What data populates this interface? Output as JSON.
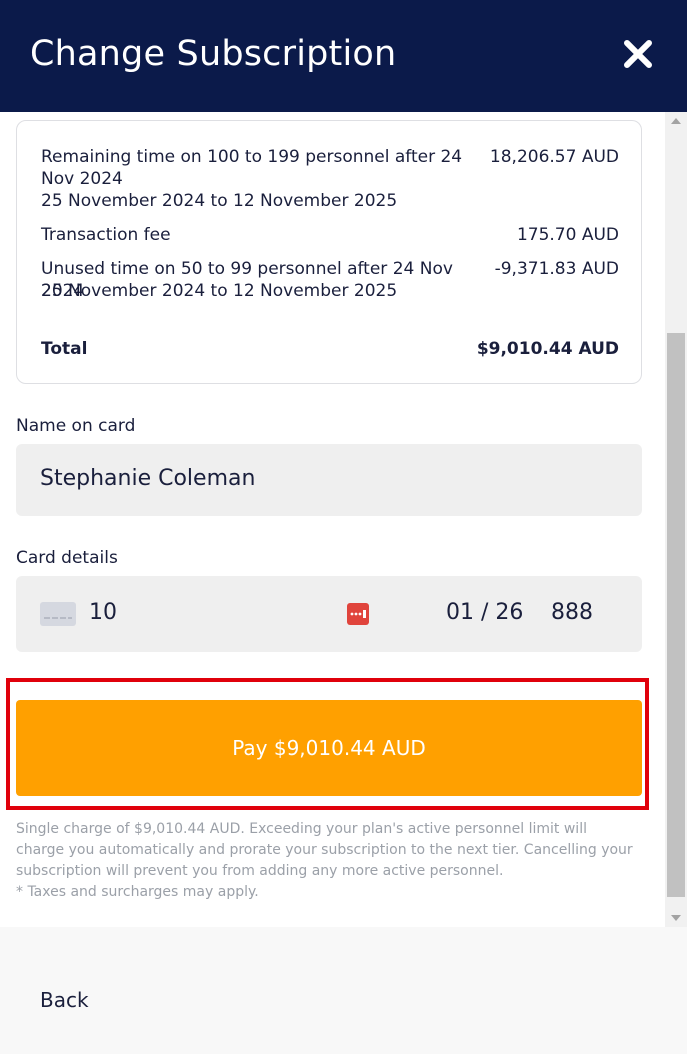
{
  "header": {
    "title": "Change Subscription",
    "close_icon": "close-icon"
  },
  "summary": {
    "items": [
      {
        "description": "Remaining time on 100 to 199 personnel after 24 Nov 2024",
        "amount": "18,206.57 AUD",
        "period": "25 November 2024  to  12 November 2025"
      },
      {
        "description": "Transaction fee",
        "amount": "175.70 AUD"
      },
      {
        "description": "Unused time on 50 to 99 personnel after 24 Nov 2024",
        "amount": "-9,371.83 AUD",
        "period": "25 November 2024  to  12 November 2025"
      }
    ],
    "total_label": "Total",
    "total_amount": "$9,010.44 AUD"
  },
  "name_on_card": {
    "label": "Name on card",
    "value": "Stephanie Coleman"
  },
  "card_details": {
    "label": "Card details",
    "number": "10",
    "expiry": "01 / 26",
    "cvc": "888",
    "card_icon": "credit-card-icon",
    "cvc_icon": "cvc-card-icon"
  },
  "pay_button": {
    "label": "Pay $9,010.44 AUD"
  },
  "fineprint": {
    "text": "Single charge of $9,010.44 AUD. Exceeding your plan's active personnel limit will charge you automatically and prorate your subscription to the next tier. Cancelling your subscription will prevent you from adding any more active personnel.",
    "note": "* Taxes and surcharges may apply."
  },
  "footer": {
    "back_label": "Back"
  },
  "colors": {
    "header_bg": "#0b1a4a",
    "pay_button": "#ffa000",
    "highlight_outline": "#e0000b"
  }
}
